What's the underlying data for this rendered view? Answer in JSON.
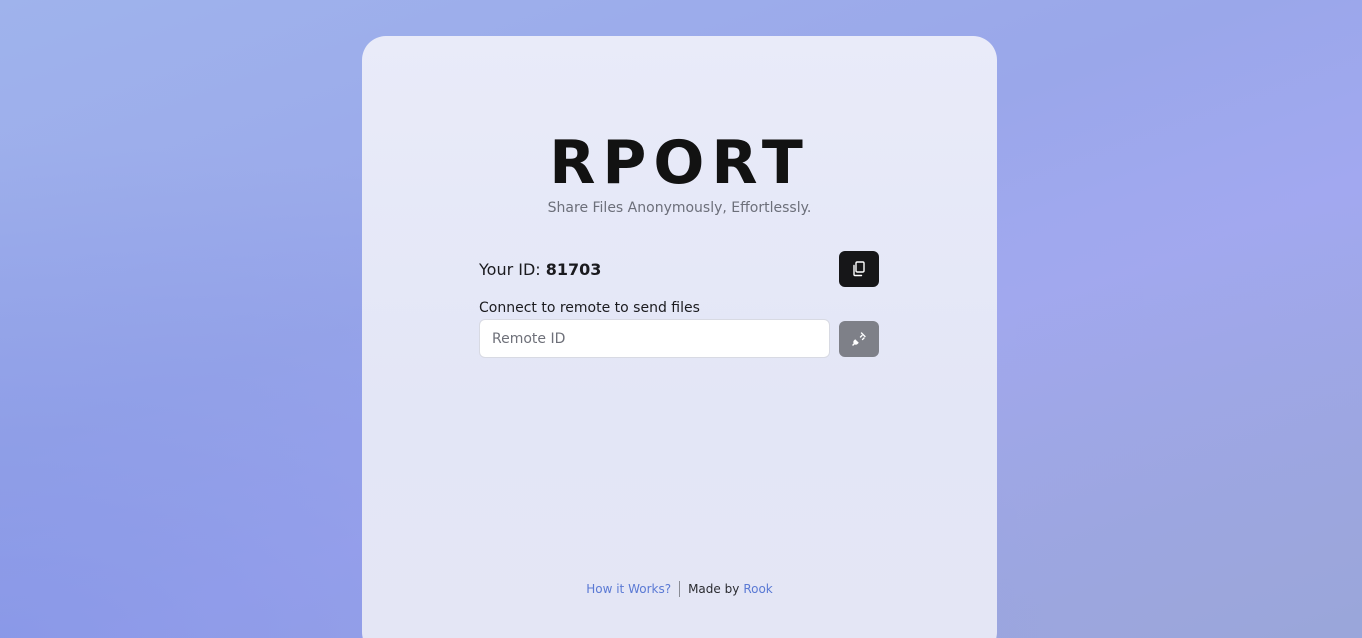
{
  "app": {
    "brand": "RPORT",
    "tagline": "Share Files Anonymously, Effortlessly."
  },
  "identity": {
    "label": "Your ID:",
    "value": "81703",
    "copy_icon": "copy-icon"
  },
  "connect": {
    "label": "Connect to remote to send files",
    "placeholder": "Remote ID",
    "value": "",
    "connect_icon": "plug-icon"
  },
  "footer": {
    "how_it_works": "How it Works?",
    "made_by": "Made by",
    "author": "Rook"
  },
  "colors": {
    "primary_button": "#161618",
    "disabled_button": "#7e8088",
    "link": "#5a79d4"
  }
}
